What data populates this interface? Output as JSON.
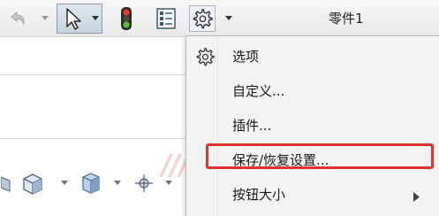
{
  "toolbar": {
    "undo_icon": "undo-icon",
    "select_icon": "select-arrow-icon",
    "traffic_light_icon": "rebuild-traffic-light-icon",
    "properties_icon": "file-properties-icon",
    "options_icon": "gear-icon",
    "document_title": "零件1"
  },
  "menu": {
    "items": [
      {
        "label": "选项",
        "icon": "gear-icon"
      },
      {
        "label": "自定义..."
      },
      {
        "label": "插件..."
      },
      {
        "label": "保存/恢复设置...",
        "highlighted": true
      },
      {
        "label": "按钮大小",
        "has_submenu": true
      }
    ]
  },
  "colors": {
    "highlight_border": "#e0322f",
    "menu_background": "#f3f3f3",
    "selected_tool_background": "#c9d3de"
  },
  "view_toolbar": {
    "icons": [
      "section-view-icon",
      "view-orientation-icon",
      "display-style-icon",
      "hide-show-icon"
    ]
  }
}
